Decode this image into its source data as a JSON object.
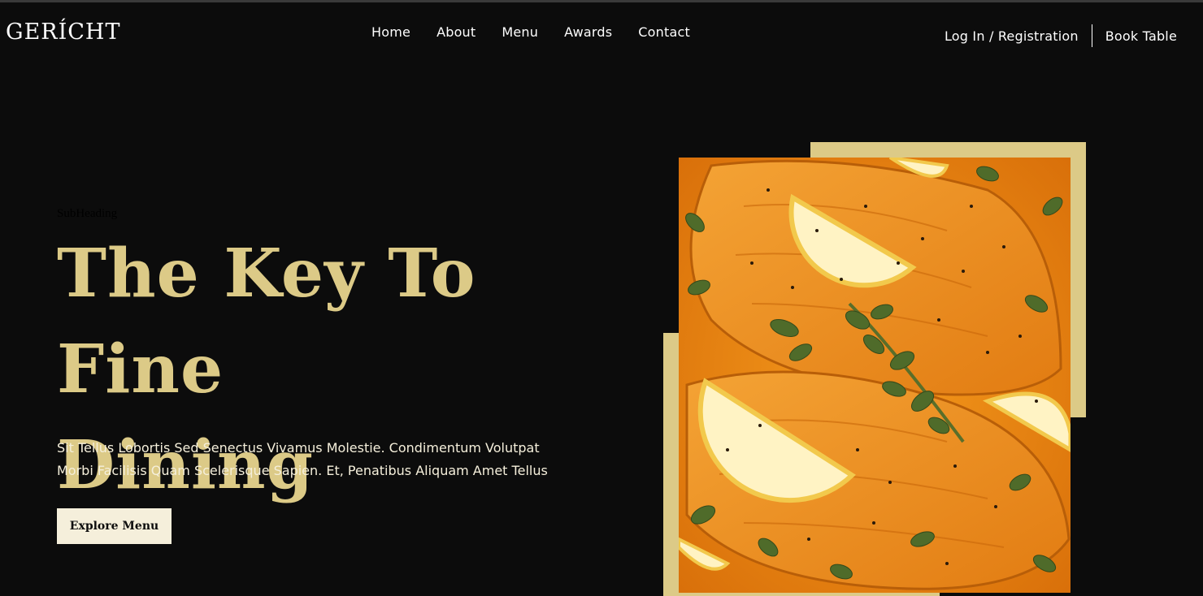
{
  "brand": {
    "logo": "GERÍCHT"
  },
  "nav": {
    "links": [
      "Home",
      "About",
      "Menu",
      "Awards",
      "Contact"
    ]
  },
  "header_actions": {
    "login": "Log In / Registration",
    "book": "Book Table"
  },
  "hero": {
    "subheading": "SubHeading",
    "headline_line1": "The Key To Fine",
    "headline_line2": "Dining",
    "description": "Sit Tellus Lobortis Sed Senectus Vivamus Molestie. Condimentum Volutpat Morbi Facilisis Quam Scelerisque Sapien. Et, Penatibus Aliquam Amet Tellus",
    "cta": "Explore Menu"
  },
  "colors": {
    "background": "#0c0c0c",
    "gold": "#dcca87",
    "cream": "#f5efdb"
  }
}
